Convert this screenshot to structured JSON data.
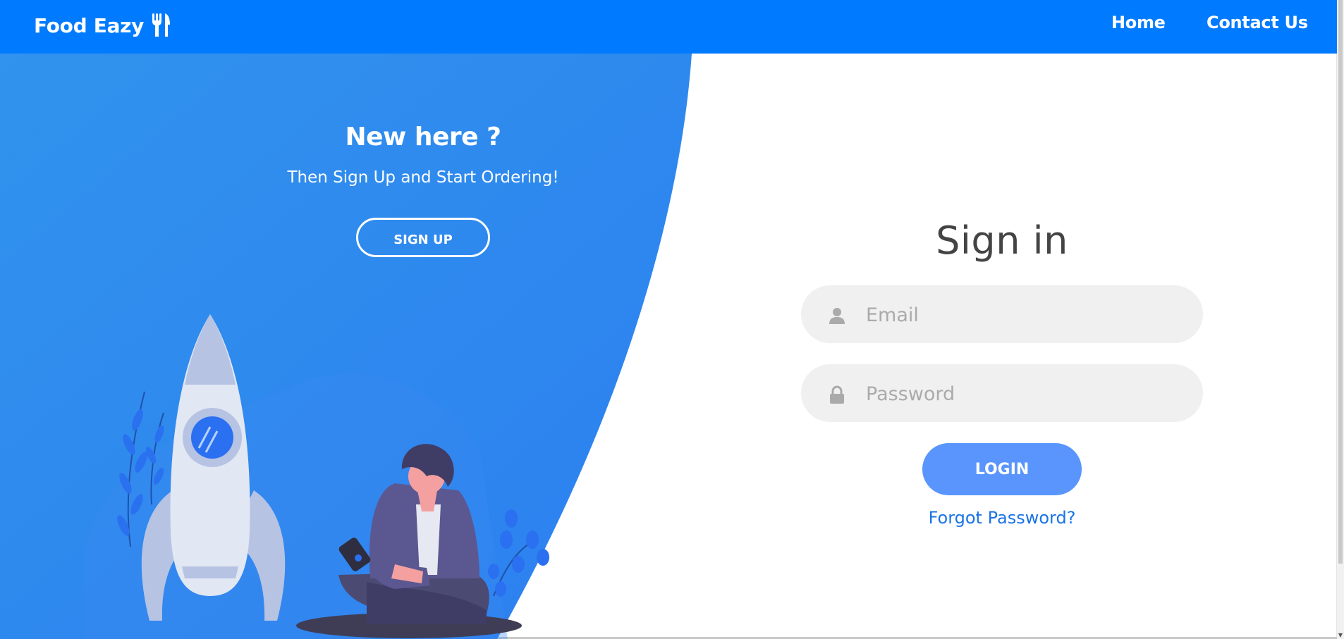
{
  "navbar": {
    "brand": "Food Eazy",
    "links": [
      "Home",
      "Contact Us"
    ]
  },
  "left_panel": {
    "title": "New here ?",
    "subtitle": "Then Sign Up and Start Ordering!",
    "signup_label": "SIGN UP"
  },
  "signin": {
    "title": "Sign in",
    "email_placeholder": "Email",
    "password_placeholder": "Password",
    "login_label": "LOGIN",
    "forgot_label": "Forgot Password?"
  },
  "colors": {
    "navbar": "#007bff",
    "panel_gradient_start": "#3193ed",
    "panel_gradient_end": "#2c7ff0",
    "login_button": "#5995fd",
    "link": "#1a73e8",
    "input_background": "#f0f0f0"
  },
  "icons": {
    "brand": "utensils-icon",
    "email": "user-icon",
    "password": "lock-icon"
  }
}
